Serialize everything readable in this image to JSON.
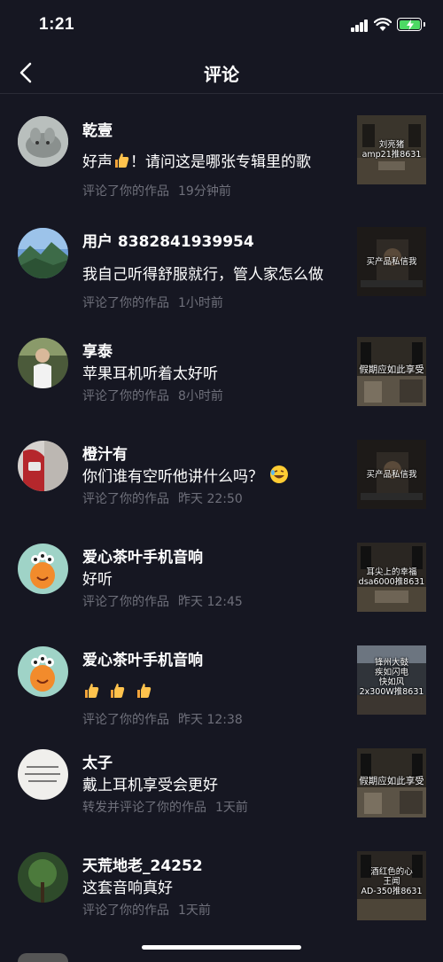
{
  "status": {
    "time": "1:21"
  },
  "header": {
    "title": "评论"
  },
  "items": [
    {
      "name": "乾壹",
      "text": "好声",
      "text_tail": "！请问这是哪张专辑里的歌",
      "action": "评论了你的作品",
      "time": "19分钟前",
      "thumb_caption": "刘亮猪\namp21推8631"
    },
    {
      "name": "用户 8382841939954",
      "text": "我自己听得舒服就行，管人家怎么做",
      "action": "评论了你的作品",
      "time": "1小时前",
      "thumb_caption": "买产品私信我"
    },
    {
      "name": "享泰",
      "text": "苹果耳机听着太好听",
      "action": "评论了你的作品",
      "time": "8小时前",
      "thumb_caption": "假期应如此享受"
    },
    {
      "name": "橙汁有",
      "text": "你们谁有空听他讲什么吗？",
      "action": "评论了你的作品",
      "time": "昨天 22:50",
      "thumb_caption": "买产品私信我"
    },
    {
      "name": "爱心茶叶手机音响",
      "text": "好听",
      "action": "评论了你的作品",
      "time": "昨天 12:45",
      "thumb_caption": "耳尖上的幸福\ndsa6000推8631"
    },
    {
      "name": "爱心茶叶手机音响",
      "text": "",
      "action": "评论了你的作品",
      "time": "昨天 12:38",
      "thumb_caption": "锋州大鼓\n疾如闪电\n快如风\n2x300W推8631"
    },
    {
      "name": "太子",
      "text": "戴上耳机享受会更好",
      "action": "转发并评论了你的作品",
      "time": "1天前",
      "thumb_caption": "假期应如此享受"
    },
    {
      "name": "天荒地老_24252",
      "text": "这套音响真好",
      "action": "评论了你的作品",
      "time": "1天前",
      "thumb_caption": "酒红色的心\n王闻\nAD-350推8631"
    }
  ]
}
